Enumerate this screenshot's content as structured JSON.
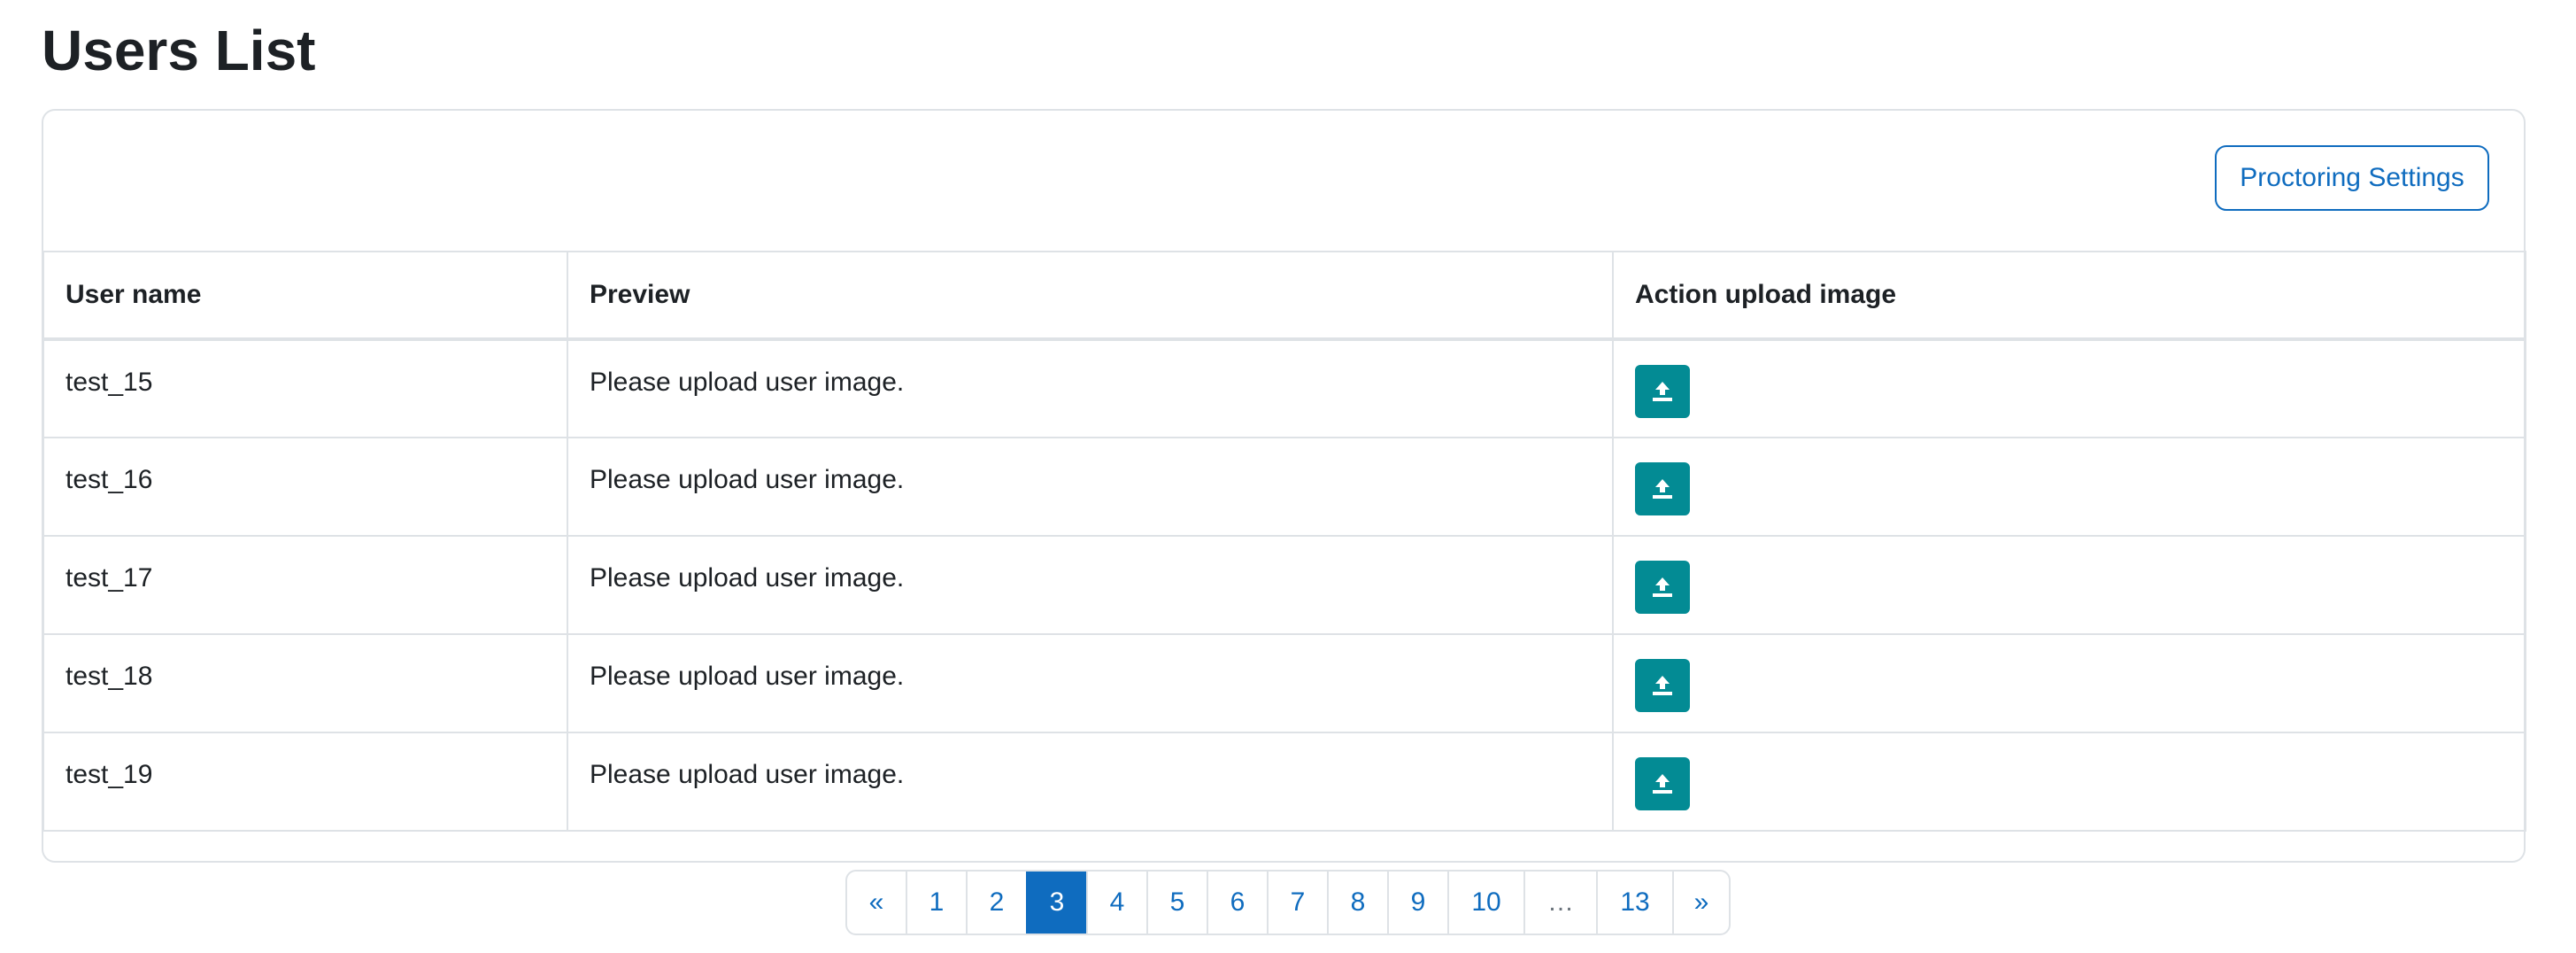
{
  "page": {
    "title": "Users List"
  },
  "toolbar": {
    "proctoring_settings_label": "Proctoring Settings"
  },
  "table": {
    "headers": [
      "User name",
      "Preview",
      "Action upload image"
    ],
    "rows": [
      {
        "username": "test_15",
        "preview": "Please upload user image."
      },
      {
        "username": "test_16",
        "preview": "Please upload user image."
      },
      {
        "username": "test_17",
        "preview": "Please upload user image."
      },
      {
        "username": "test_18",
        "preview": "Please upload user image."
      },
      {
        "username": "test_19",
        "preview": "Please upload user image."
      }
    ],
    "action_icon": "upload-icon"
  },
  "pagination": {
    "prev_label": "«",
    "next_label": "»",
    "pages": [
      "1",
      "2",
      "3",
      "4",
      "5",
      "6",
      "7",
      "8",
      "9",
      "10",
      "…",
      "13"
    ],
    "current_page": "3"
  },
  "colors": {
    "accent": "#0f6cbf",
    "action_button": "#038b94",
    "border": "#dee2e6",
    "text": "#1d2125"
  }
}
